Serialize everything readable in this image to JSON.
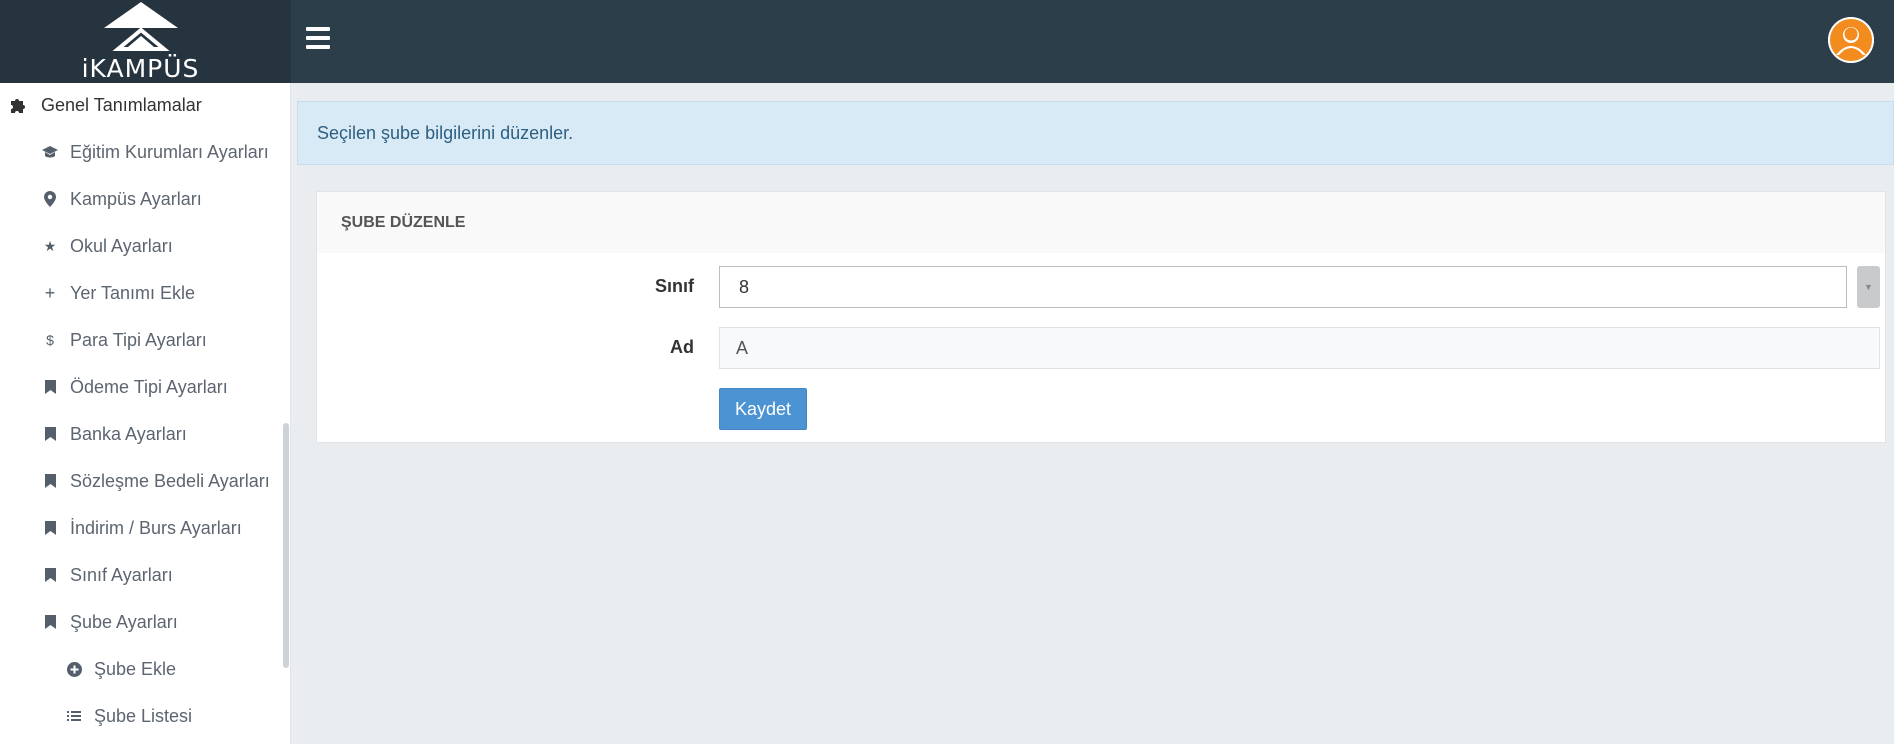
{
  "header": {
    "logo_text": "iKAMPÜS",
    "menu_icon": "hamburger-icon",
    "avatar_icon": "user-avatar-icon"
  },
  "sidebar": {
    "section_title": "Genel Tanımlamalar",
    "section_icon": "puzzle-icon",
    "items": [
      {
        "label": "Eğitim Kurumları Ayarları",
        "icon": "graduation-cap-icon"
      },
      {
        "label": "Kampüs Ayarları",
        "icon": "map-marker-icon"
      },
      {
        "label": "Okul Ayarları",
        "icon": "star-icon"
      },
      {
        "label": "Yer Tanımı Ekle",
        "icon": "plus-icon"
      },
      {
        "label": "Para Tipi Ayarları",
        "icon": "dollar-icon"
      },
      {
        "label": "Ödeme Tipi Ayarları",
        "icon": "bookmark-icon"
      },
      {
        "label": "Banka Ayarları",
        "icon": "bookmark-icon"
      },
      {
        "label": "Sözleşme Bedeli Ayarları",
        "icon": "bookmark-icon"
      },
      {
        "label": "İndirim / Burs Ayarları",
        "icon": "bookmark-icon"
      },
      {
        "label": "Sınıf Ayarları",
        "icon": "bookmark-icon"
      },
      {
        "label": "Şube Ayarları",
        "icon": "bookmark-icon"
      }
    ],
    "sub_items": [
      {
        "label": "Şube Ekle",
        "icon": "plus-circle-icon"
      },
      {
        "label": "Şube Listesi",
        "icon": "list-icon"
      }
    ]
  },
  "main": {
    "alert_text": "Seçilen şube bilgilerini düzenler.",
    "panel_title": "ŞUBE DÜZENLE",
    "form": {
      "class_label": "Sınıf",
      "class_value": "8",
      "name_label": "Ad",
      "name_value": "A",
      "save_label": "Kaydet"
    }
  },
  "colors": {
    "header_bg": "#2d3e4b",
    "logo_bg": "#263440",
    "alert_bg": "#d9eaf7",
    "button_bg": "#4c93d3",
    "page_bg": "#e9edf0"
  }
}
